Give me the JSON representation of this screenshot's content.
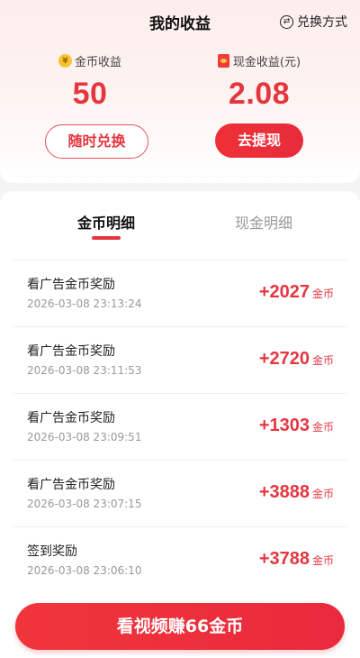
{
  "header": {
    "title": "我的收益",
    "exchange_method": "兑换方式",
    "exchange_icon": "swap-icon"
  },
  "coins": {
    "label": "金币收益",
    "value": "50",
    "button": "随时兑换",
    "icon": "coin-icon"
  },
  "cash": {
    "label": "现金收益(元)",
    "value": "2.08",
    "button": "去提现",
    "icon": "red-packet-icon"
  },
  "tabs": [
    {
      "label": "金币明细",
      "active": true
    },
    {
      "label": "现金明细",
      "active": false
    }
  ],
  "records": [
    {
      "title": "看广告金币奖励",
      "time": "2026-03-08 23:13:24",
      "amount": "+2027",
      "unit": "金币"
    },
    {
      "title": "看广告金币奖励",
      "time": "2026-03-08 23:11:53",
      "amount": "+2720",
      "unit": "金币"
    },
    {
      "title": "看广告金币奖励",
      "time": "2026-03-08 23:09:51",
      "amount": "+1303",
      "unit": "金币"
    },
    {
      "title": "看广告金币奖励",
      "time": "2026-03-08 23:07:15",
      "amount": "+3888",
      "unit": "金币"
    },
    {
      "title": "签到奖励",
      "time": "2026-03-08 23:06:10",
      "amount": "+3788",
      "unit": "金币"
    }
  ],
  "cta": {
    "label": "看视频赚66金币"
  },
  "colors": {
    "accent": "#e53640",
    "muted": "#999999"
  }
}
